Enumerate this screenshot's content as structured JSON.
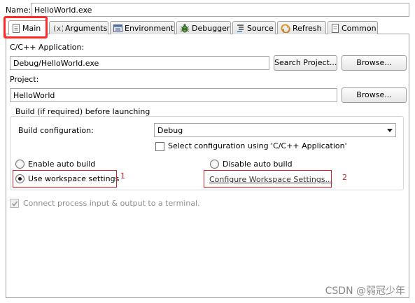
{
  "name_row": {
    "label": "Name:",
    "value": "HelloWorld.exe"
  },
  "tabs": [
    {
      "label": "Main",
      "icon": "main-doc-icon"
    },
    {
      "label": "Arguments",
      "icon": "arguments-icon"
    },
    {
      "label": "Environment",
      "icon": "environment-icon"
    },
    {
      "label": "Debugger",
      "icon": "debugger-bug-icon"
    },
    {
      "label": "Source",
      "icon": "source-icon"
    },
    {
      "label": "Refresh",
      "icon": "refresh-icon"
    },
    {
      "label": "Common",
      "icon": "common-icon"
    }
  ],
  "application": {
    "label": "C/C++ Application:",
    "value": "Debug/HelloWorld.exe",
    "search_button": "Search Project...",
    "browse_button": "Browse..."
  },
  "project": {
    "label": "Project:",
    "value": "HelloWorld",
    "browse_button": "Browse..."
  },
  "build": {
    "group_label": "Build (if required) before launching",
    "config_label": "Build configuration:",
    "config_value": "Debug",
    "select_config_label": "Select configuration using 'C/C++ Application'",
    "enable_auto_build": "Enable auto build",
    "disable_auto_build": "Disable auto build",
    "use_workspace_settings": "Use workspace settings",
    "configure_workspace": "Configure Workspace Settings...",
    "annotation_1": "1",
    "annotation_2": "2"
  },
  "terminal": {
    "label": "Connect process input & output to a terminal."
  },
  "watermark": "CSDN @弱冠少年",
  "colors": {
    "annotation_red": "#d02020",
    "highlight_red": "#ff2a2a"
  }
}
